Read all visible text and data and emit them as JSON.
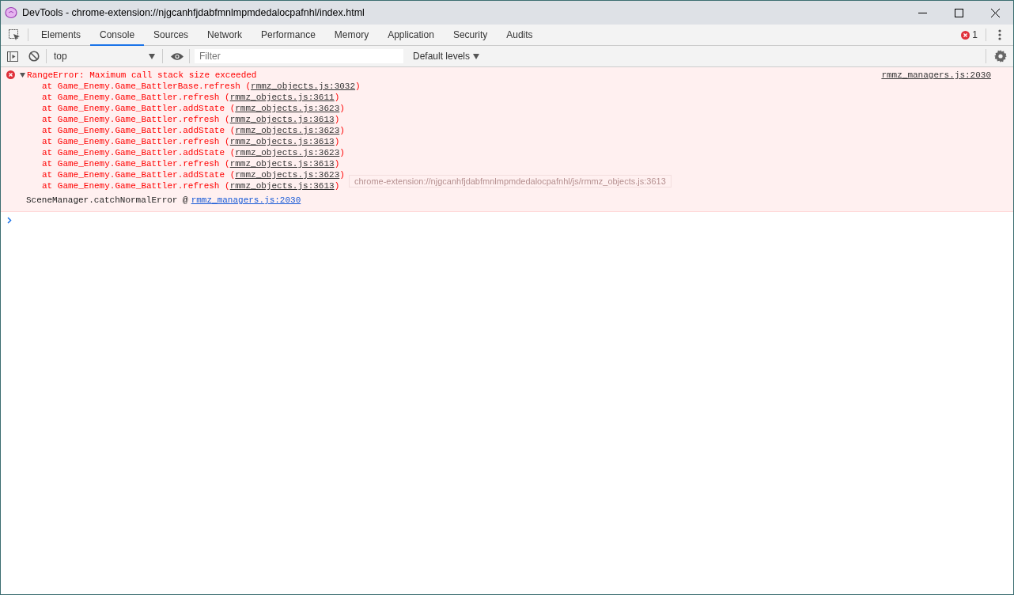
{
  "window": {
    "title": "DevTools - chrome-extension://njgcanhfjdabfmnlmpmdedalocpafnhl/index.html"
  },
  "tabs": [
    {
      "label": "Elements",
      "selected": false
    },
    {
      "label": "Console",
      "selected": true
    },
    {
      "label": "Sources",
      "selected": false
    },
    {
      "label": "Network",
      "selected": false
    },
    {
      "label": "Performance",
      "selected": false
    },
    {
      "label": "Memory",
      "selected": false
    },
    {
      "label": "Application",
      "selected": false
    },
    {
      "label": "Security",
      "selected": false
    },
    {
      "label": "Audits",
      "selected": false
    }
  ],
  "error_count": "1",
  "toolbar": {
    "context": "top",
    "filter": {
      "placeholder": "Filter"
    },
    "levels": "Default levels"
  },
  "messages": [
    {
      "kind": "error",
      "expanded": true,
      "text": "RangeError: Maximum call stack size exceeded",
      "source": "rmmz_managers.js:2030",
      "stack": [
        {
          "call": "at Game_Enemy.Game_BattlerBase.refresh (",
          "link": "rmmz_objects.js:3032",
          "close": ")"
        },
        {
          "call": "at Game_Enemy.Game_Battler.refresh (",
          "link": "rmmz_objects.js:3611",
          "close": ")"
        },
        {
          "call": "at Game_Enemy.Game_Battler.addState (",
          "link": "rmmz_objects.js:3623",
          "close": ")"
        },
        {
          "call": "at Game_Enemy.Game_Battler.refresh (",
          "link": "rmmz_objects.js:3613",
          "close": ")"
        },
        {
          "call": "at Game_Enemy.Game_Battler.addState (",
          "link": "rmmz_objects.js:3623",
          "close": ")"
        },
        {
          "call": "at Game_Enemy.Game_Battler.refresh (",
          "link": "rmmz_objects.js:3613",
          "close": ")"
        },
        {
          "call": "at Game_Enemy.Game_Battler.addState (",
          "link": "rmmz_objects.js:3623",
          "close": ")"
        },
        {
          "call": "at Game_Enemy.Game_Battler.refresh (",
          "link": "rmmz_objects.js:3613",
          "close": ")"
        },
        {
          "call": "at Game_Enemy.Game_Battler.addState (",
          "link": "rmmz_objects.js:3623",
          "close": ")"
        },
        {
          "call": "at Game_Enemy.Game_Battler.refresh (",
          "link": "rmmz_objects.js:3613",
          "close": ")"
        }
      ],
      "caller": {
        "text": "SceneManager.catchNormalError @",
        "link": "rmmz_managers.js:2030"
      }
    }
  ],
  "tooltip": "chrome-extension://njgcanhfjdabfmnlmpmdedalocpafnhl/js/rmmz_objects.js:3613"
}
